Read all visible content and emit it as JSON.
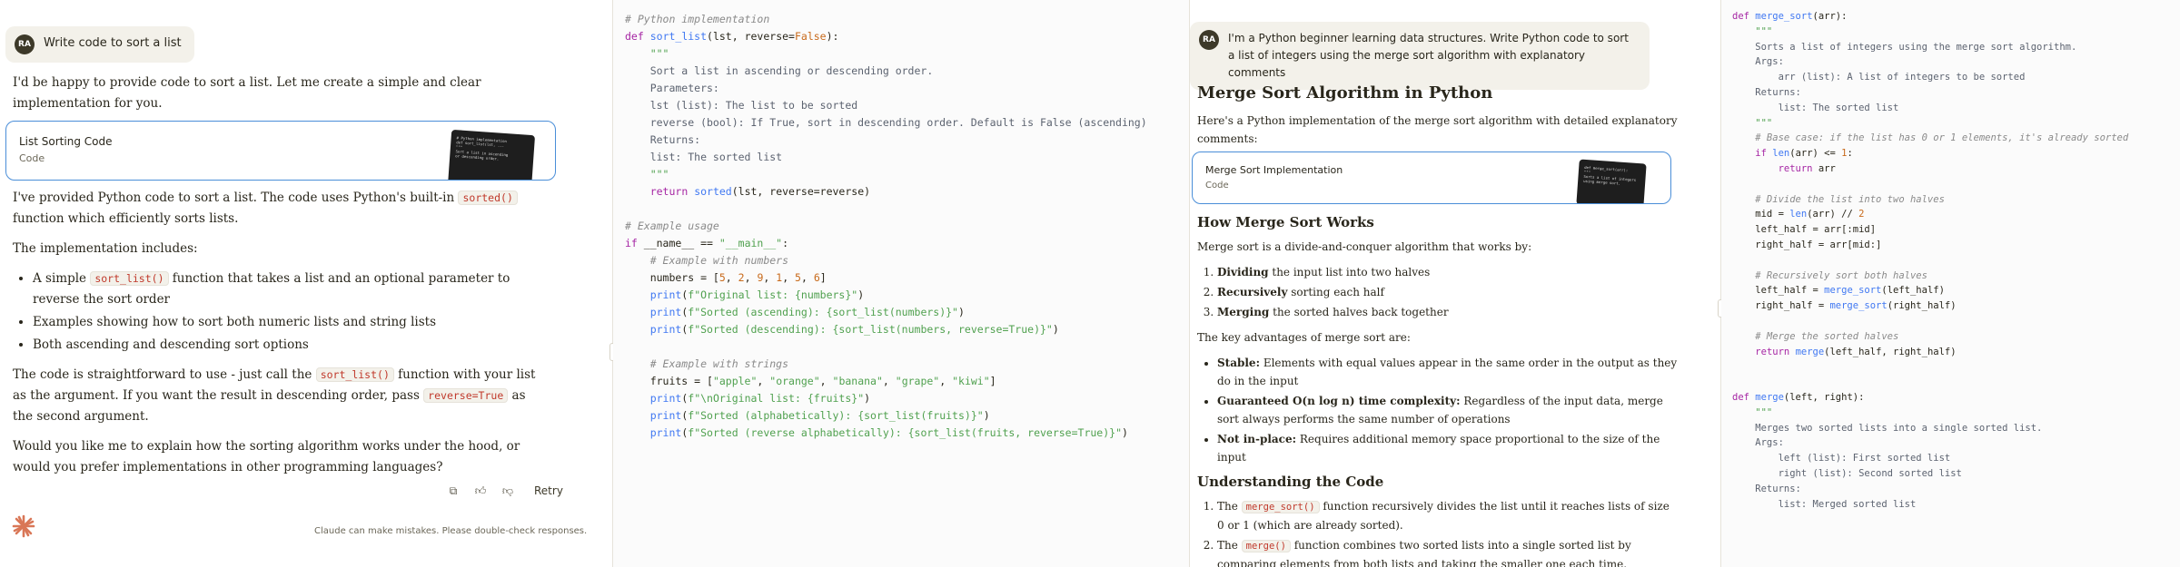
{
  "panel1": {
    "user_avatar": "RA",
    "user_message": "Write code to sort a list",
    "intro": "I'd be happy to provide code to sort a list. Let me create a simple and clear implementation for you.",
    "artifact": {
      "title": "List Sorting Code",
      "subtitle": "Code"
    },
    "p1_pre": "I've provided Python code to sort a list. The code uses Python's built-in ",
    "p1_code": "sorted()",
    "p1_post": " function which efficiently sorts lists.",
    "includes": "The implementation includes:",
    "bullet1_pre": "A simple ",
    "bullet1_code": "sort_list()",
    "bullet1_post": " function that takes a list and an optional parameter to reverse the sort order",
    "bullet2": "Examples showing how to sort both numeric lists and string lists",
    "bullet3": "Both ascending and descending sort options",
    "p2_pre": "The code is straightforward to use - just call the ",
    "p2_code": "sort_list()",
    "p2_mid": " function with your list as the argument. If you want the result in descending order, pass ",
    "p2_code2": "reverse=True",
    "p2_post": " as the second argument.",
    "p3": "Would you like me to explain how the sorting algorithm works under the hood, or would you prefer implementations in other programming languages?",
    "retry": "Retry",
    "disclaimer": "Claude can make mistakes. Please double-check responses."
  },
  "code1": [
    "# Python implementation",
    "def sort_list(lst, reverse=False):",
    "    \"\"\"",
    "    Sort a list in ascending or descending order.",
    "",
    "    Parameters:",
    "    lst (list): The list to be sorted",
    "    reverse (bool): If True, sort in descending order. Default is False (ascending)",
    "",
    "    Returns:",
    "    list: The sorted list",
    "    \"\"\"",
    "    return sorted(lst, reverse=reverse)",
    "",
    "# Example usage",
    "if __name__ == \"__main__\":",
    "    # Example with numbers",
    "    numbers = [5, 2, 9, 1, 5, 6]",
    "    print(f\"Original list: {numbers}\")",
    "    print(f\"Sorted (ascending): {sort_list(numbers)}\")",
    "    print(f\"Sorted (descending): {sort_list(numbers, reverse=True)}\")",
    "",
    "    # Example with strings",
    "    fruits = [\"apple\", \"orange\", \"banana\", \"grape\", \"kiwi\"]",
    "    print(f\"\\nOriginal list: {fruits}\")",
    "    print(f\"Sorted (alphabetically): {sort_list(fruits)}\")",
    "    print(f\"Sorted (reverse alphabetically): {sort_list(fruits, reverse=True)}\")"
  ],
  "panel3": {
    "user_avatar": "RA",
    "user_message": "I'm a Python beginner learning data structures. Write Python code to sort a list of integers using the merge sort algorithm with explanatory comments",
    "heading": "Merge Sort Algorithm in Python",
    "intro": "Here's a Python implementation of the merge sort algorithm with detailed explanatory comments:",
    "artifact": {
      "title": "Merge Sort Implementation",
      "subtitle": "Code"
    },
    "how_heading": "How Merge Sort Works",
    "how_intro": "Merge sort is a divide-and-conquer algorithm that works by:",
    "steps": [
      {
        "bold": "Dividing",
        "text": " the input list into two halves"
      },
      {
        "bold": "Recursively",
        "text": " sorting each half"
      },
      {
        "bold": "Merging",
        "text": " the sorted halves back together"
      }
    ],
    "adv_intro": "The key advantages of merge sort are:",
    "advantages": [
      {
        "bold": "Stable:",
        "text": " Elements with equal values appear in the same order in the output as they do in the input"
      },
      {
        "bold": "Guaranteed O(n log n) time complexity:",
        "text": " Regardless of the input data, merge sort always performs the same number of operations"
      },
      {
        "bold": "Not in-place:",
        "text": " Requires additional memory space proportional to the size of the input"
      }
    ],
    "understand_heading": "Understanding the Code",
    "u1_pre": "The ",
    "u1_code": "merge_sort()",
    "u1_post": " function recursively divides the list until it reaches lists of size 0 or 1 (which are already sorted).",
    "u2_pre": "The ",
    "u2_code": "merge()",
    "u2_post": " function combines two sorted lists into a single sorted list by comparing elements from both lists and taking the smaller one each time."
  },
  "code2": [
    "def merge_sort(arr):",
    "    \"\"\"",
    "    Sorts a list of integers using the merge sort algorithm.",
    "",
    "    Args:",
    "        arr (list): A list of integers to be sorted",
    "",
    "    Returns:",
    "        list: The sorted list",
    "    \"\"\"",
    "    # Base case: if the list has 0 or 1 elements, it's already sorted",
    "    if len(arr) <= 1:",
    "        return arr",
    "",
    "    # Divide the list into two halves",
    "    mid = len(arr) // 2",
    "    left_half = arr[:mid]",
    "    right_half = arr[mid:]",
    "",
    "    # Recursively sort both halves",
    "    left_half = merge_sort(left_half)",
    "    right_half = merge_sort(right_half)",
    "",
    "    # Merge the sorted halves",
    "    return merge(left_half, right_half)",
    "",
    "",
    "def merge(left, right):",
    "    \"\"\"",
    "    Merges two sorted lists into a single sorted list.",
    "",
    "    Args:",
    "        left (list): First sorted list",
    "        right (list): Second sorted list",
    "",
    "    Returns:",
    "        list: Merged sorted list"
  ]
}
